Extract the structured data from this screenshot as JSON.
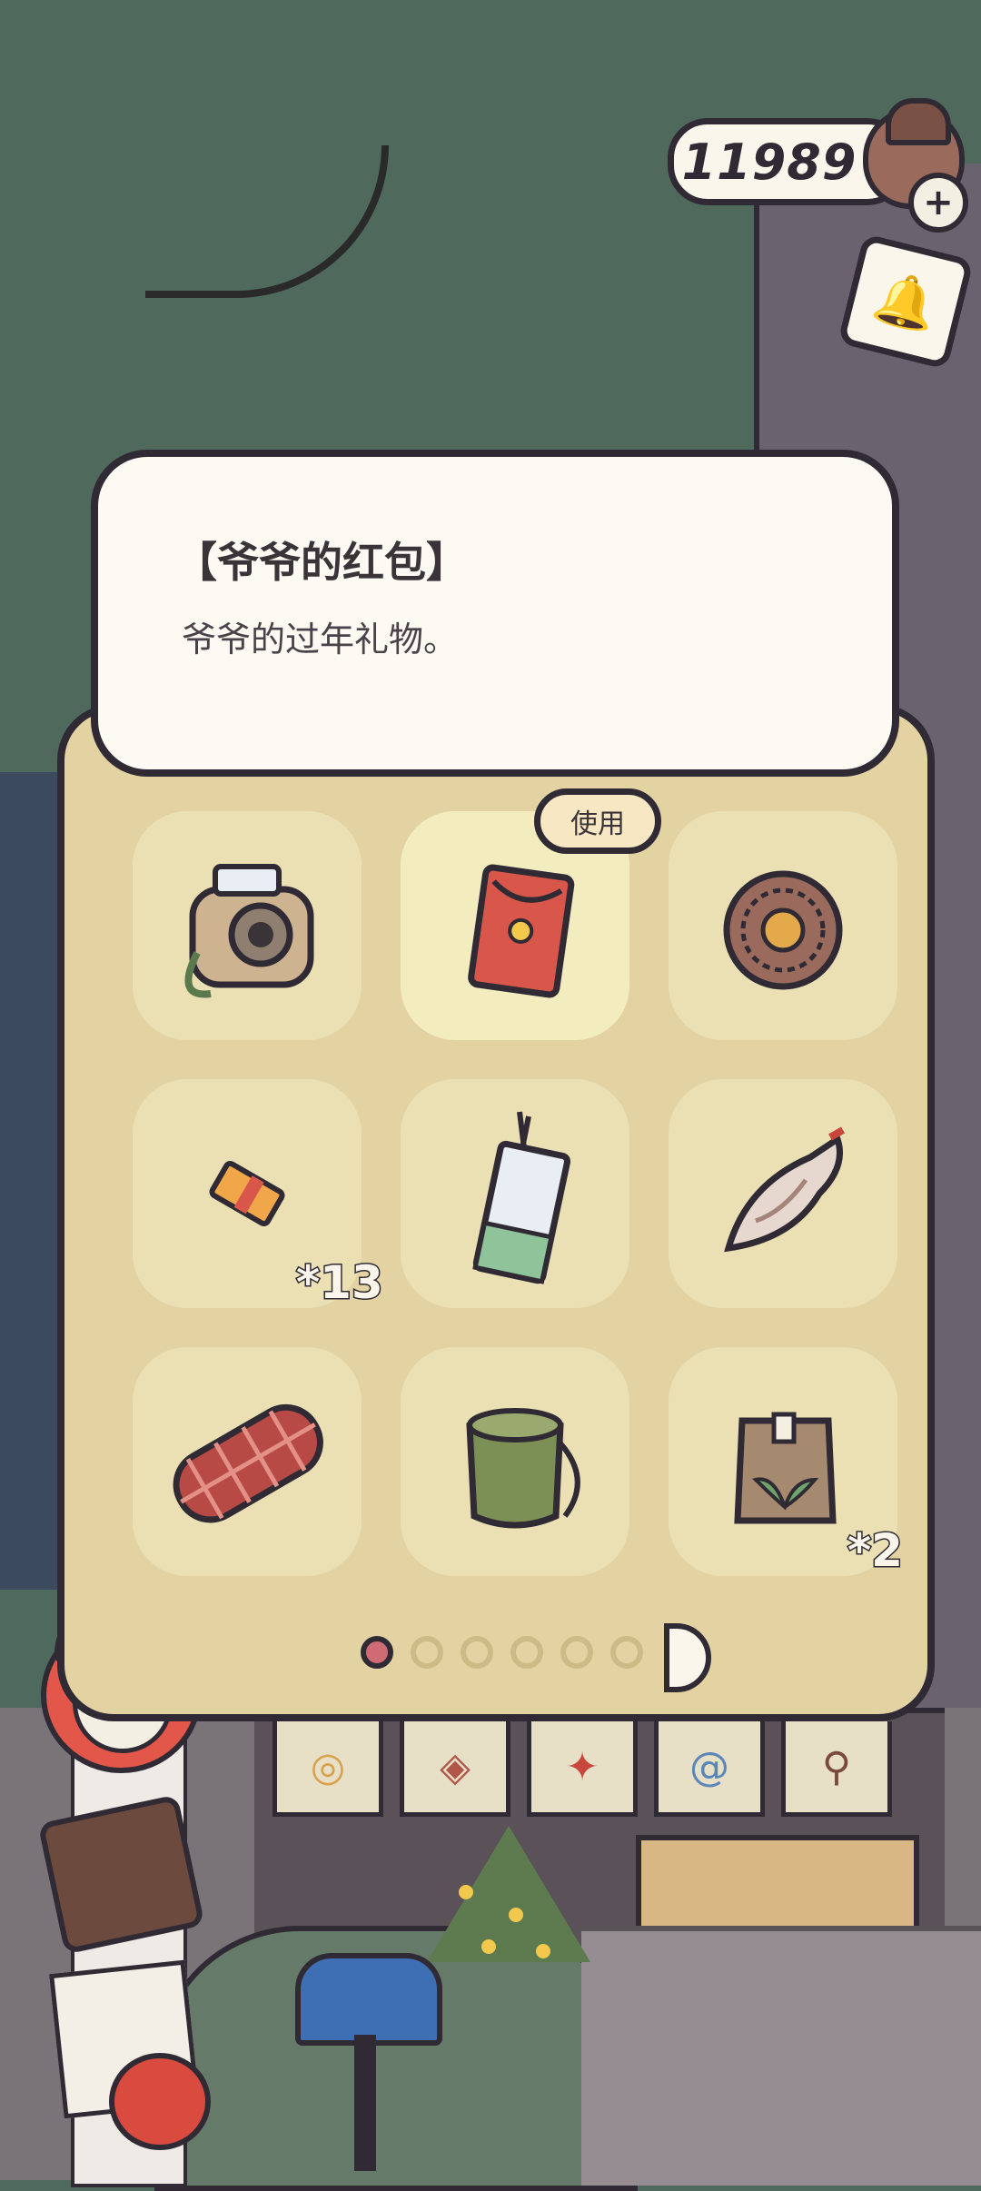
{
  "currency": {
    "value": "11989",
    "icon": "acorn-icon",
    "plus_label": "+",
    "bell_icon": "bell-icon"
  },
  "item_detail": {
    "title": "【爷爷的红包】",
    "description": "爷爷的过年礼物。"
  },
  "inventory": {
    "use_label": "使用",
    "slots": [
      {
        "icon": "camera-icon",
        "quantity": ""
      },
      {
        "icon": "red-envelope-icon",
        "quantity": "",
        "selected": true
      },
      {
        "icon": "coin-icon",
        "quantity": ""
      },
      {
        "icon": "ticket-icon",
        "quantity": "*13"
      },
      {
        "icon": "tag-icon",
        "quantity": ""
      },
      {
        "icon": "seashell-icon",
        "quantity": ""
      },
      {
        "icon": "blanket-icon",
        "quantity": ""
      },
      {
        "icon": "pouch-icon",
        "quantity": ""
      },
      {
        "icon": "seed-bag-icon",
        "quantity": "*2"
      }
    ],
    "page_indicator": {
      "current": 1,
      "total": 6
    }
  },
  "colors": {
    "panel": "#e3d3a3",
    "slot": "#ebdfb4",
    "slot_selected": "#f2ecbf",
    "outline": "#2f2a33",
    "card": "#fdf9f3",
    "page_dot_active": "#cf6b74"
  }
}
